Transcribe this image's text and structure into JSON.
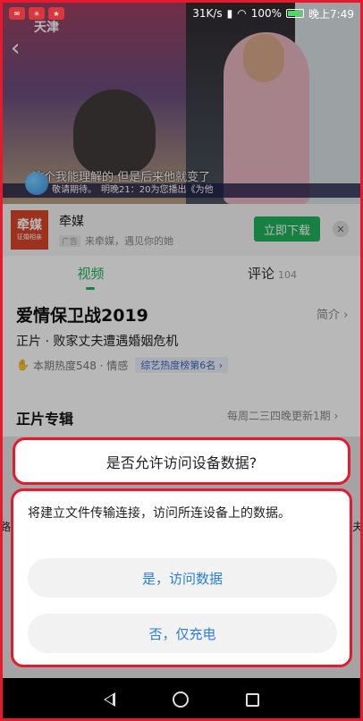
{
  "status_bar": {
    "network_speed": "31K/s",
    "battery": "100%",
    "time": "晚上7:49"
  },
  "video": {
    "channel_logo": "天津",
    "subtitle": "这个我能理解的 但是后来他就变了",
    "ticker": "敬请期待。　明晚21：20为您播出《为他"
  },
  "ad": {
    "logo_text": "牵媒",
    "logo_sub": "征婚相亲",
    "name": "牵媒",
    "tag": "广告",
    "description": "来牵媒，遇见你的她",
    "download_button": "立即下载"
  },
  "tabs": {
    "video": "视频",
    "comment": "评论",
    "comment_count": "104"
  },
  "show": {
    "title": "爱情保卫战2019",
    "intro_link": "简介 ›",
    "episode_desc": "正片 · 败家丈夫遭遇婚姻危机",
    "heat": "本期热度548 · 情感",
    "rank": "综艺热度榜第6名 ›"
  },
  "section": {
    "title": "正片专辑",
    "update": "每周二三四晚更新1期 ›"
  },
  "dialog": {
    "title": "是否允许访问设备数据?",
    "message": "将建立文件传输连接，访问所连设备上的数据。",
    "yes_button": "是，访问数据",
    "no_button": "否，仅充电"
  }
}
